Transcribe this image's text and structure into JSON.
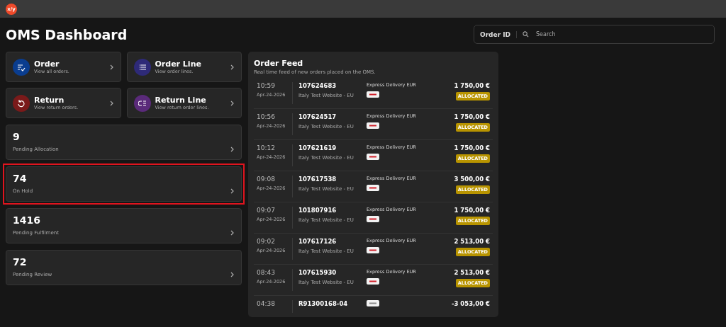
{
  "app_logo": "x/y",
  "page_title": "OMS Dashboard",
  "search": {
    "label": "Order ID",
    "placeholder": "Search"
  },
  "nav_cards": [
    {
      "kind": "order",
      "title": "Order",
      "subtitle": "View all orders.",
      "color": "#0a3d8f"
    },
    {
      "kind": "lines",
      "title": "Order Line",
      "subtitle": "View order lines.",
      "color": "#2e2a78"
    },
    {
      "kind": "return",
      "title": "Return",
      "subtitle": "View return orders.",
      "color": "#7a1a1a"
    },
    {
      "kind": "return-lines",
      "title": "Return Line",
      "subtitle": "View return order lines.",
      "color": "#5a2a7a"
    }
  ],
  "stats": [
    {
      "count": "9",
      "label": "Pending Allocation",
      "highlighted": false
    },
    {
      "count": "74",
      "label": "On Hold",
      "highlighted": true
    },
    {
      "count": "1416",
      "label": "Pending Fulfilment",
      "highlighted": false
    },
    {
      "count": "72",
      "label": "Pending Review",
      "highlighted": false
    }
  ],
  "order_feed": {
    "title": "Order Feed",
    "subtitle": "Real time feed of new orders placed on the OMS.",
    "orders": [
      {
        "time": "10:59",
        "date": "Apr-24-2026",
        "order_id": "107624683",
        "store": "Italy Test Website - EU",
        "shipping": "Express Delivery EUR",
        "color": "#d0202a",
        "amount": "1 750,00 €",
        "status": "ALLOCATED"
      },
      {
        "time": "10:56",
        "date": "Apr-24-2026",
        "order_id": "107624517",
        "store": "Italy Test Website - EU",
        "shipping": "Express Delivery EUR",
        "color": "#d0202a",
        "amount": "1 750,00 €",
        "status": "ALLOCATED"
      },
      {
        "time": "10:12",
        "date": "Apr-24-2026",
        "order_id": "107621619",
        "store": "Italy Test Website - EU",
        "shipping": "Express Delivery EUR",
        "color": "#d0202a",
        "amount": "1 750,00 €",
        "status": "ALLOCATED"
      },
      {
        "time": "09:08",
        "date": "Apr-24-2026",
        "order_id": "107617538",
        "store": "Italy Test Website - EU",
        "shipping": "Express Delivery EUR",
        "color": "#d0202a",
        "amount": "3 500,00 €",
        "status": "ALLOCATED"
      },
      {
        "time": "09:07",
        "date": "Apr-24-2026",
        "order_id": "101807916",
        "store": "Italy Test Website - EU",
        "shipping": "Express Delivery EUR",
        "color": "#d0202a",
        "amount": "1 750,00 €",
        "status": "ALLOCATED"
      },
      {
        "time": "09:02",
        "date": "Apr-24-2026",
        "order_id": "107617126",
        "store": "Italy Test Website - EU",
        "shipping": "Express Delivery EUR",
        "color": "#d0202a",
        "amount": "2 513,00 €",
        "status": "ALLOCATED"
      },
      {
        "time": "08:43",
        "date": "Apr-24-2026",
        "order_id": "107615930",
        "store": "Italy Test Website - EU",
        "shipping": "Express Delivery EUR",
        "color": "#d0202a",
        "amount": "2 513,00 €",
        "status": "ALLOCATED"
      },
      {
        "time": "04:38",
        "order_id": "R91300168-04",
        "color": "#8a8a8a",
        "amount": "-3 053,00 €"
      }
    ]
  }
}
